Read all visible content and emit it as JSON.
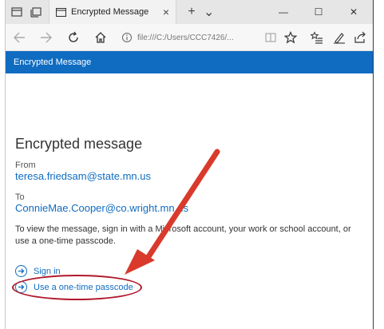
{
  "browser": {
    "tab_title": "Encrypted Message",
    "tab_close": "×",
    "new_tab": "+",
    "tab_dropdown": "⌄",
    "minimize": "—",
    "maximize": "☐",
    "close": "✕",
    "address": "file:///C:/Users/CCC7426/...",
    "more": "···"
  },
  "app_header": {
    "title": "Encrypted Message"
  },
  "message": {
    "heading": "Encrypted message",
    "from_label": "From",
    "from_email": "teresa.friedsam@state.mn.us",
    "to_label": "To",
    "to_email": "ConnieMae.Cooper@co.wright.mn.us",
    "instructions": "To view the message, sign in with a Microsoft account, your work or school account, or use a one-time passcode.",
    "sign_in_label": "Sign in",
    "passcode_label": "Use a one-time passcode"
  },
  "colors": {
    "accent": "#0f6cc1",
    "annotation": "#d93a2b",
    "highlight": "#b0182a"
  },
  "icons": {
    "sign_in": "arrow-right-circle-icon",
    "passcode": "arrow-right-circle-icon",
    "address_info": "info-icon"
  }
}
